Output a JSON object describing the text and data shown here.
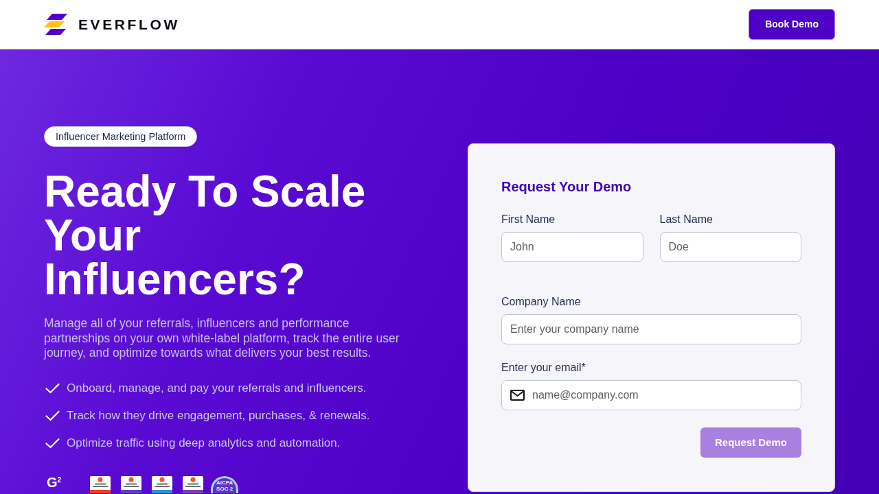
{
  "header": {
    "logo_text": "EVERFLOW",
    "cta": {
      "label": "Book Demo"
    }
  },
  "hero": {
    "tag": "Influencer Marketing Platform",
    "heading": "Ready To Scale Your Influencers?",
    "description": "Manage all of your referrals, influencers and performance partnerships on your own white-label platform, track the entire user journey, and optimize towards what delivers your best results.",
    "features": [
      "Onboard, manage, and pay your referrals and influencers.",
      "Track how they drive engagement, purchases, & renewals.",
      "Optimize traffic using deep analytics and automation."
    ],
    "g2_logo": "G$^{2}$",
    "badges": [
      {
        "color": "#e8412c"
      },
      {
        "color": "#5b3fc4"
      },
      {
        "color": "#2f8fe0"
      },
      {
        "color": "#7a3fc0"
      }
    ],
    "certification": {
      "lines": [
        "AICPA",
        "SOC 2"
      ]
    }
  },
  "form": {
    "title": "Request Your Demo",
    "rows": [
      {
        "fields": [
          {
            "kind": "text",
            "label": "First Name",
            "placeholder": "John"
          },
          {
            "kind": "text",
            "label": "Last Name",
            "placeholder": "Doe"
          }
        ]
      },
      {
        "fields": [
          {
            "kind": "text",
            "label": "Company Name",
            "placeholder": "Enter your company name"
          }
        ]
      },
      {
        "fields": [
          {
            "kind": "email",
            "label": "Enter your email*",
            "placeholder": "name@company.com"
          }
        ]
      }
    ],
    "submit": {
      "label": "Request Demo",
      "disabled": true
    }
  }
}
